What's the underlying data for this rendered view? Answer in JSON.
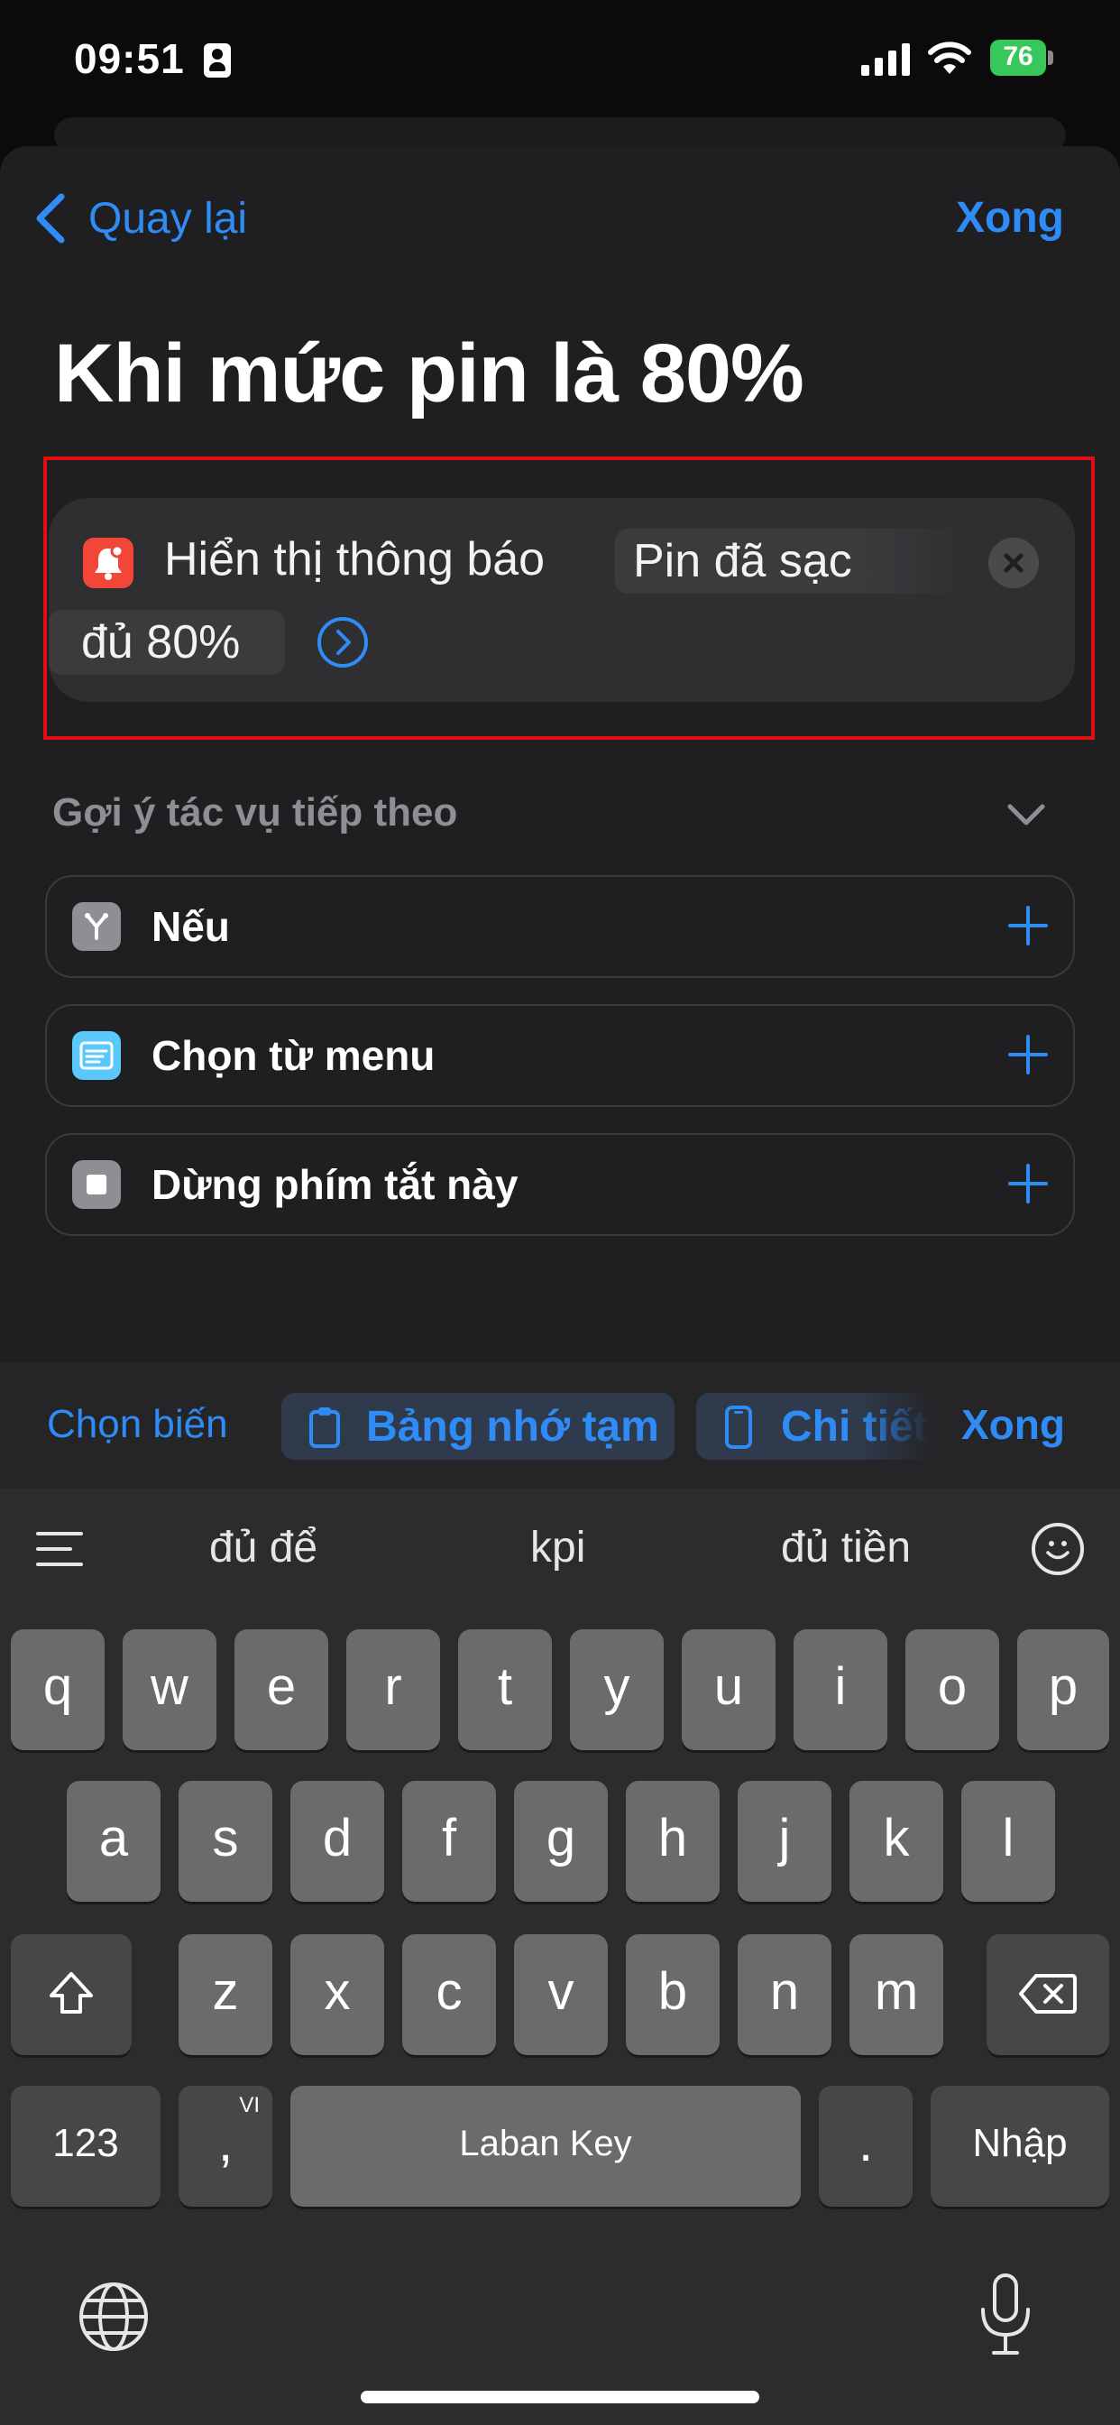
{
  "status_bar": {
    "time": "09:51",
    "battery": "76"
  },
  "nav": {
    "back_label": "Quay lại",
    "done_label": "Xong"
  },
  "title": "Khi mức pin là 80%",
  "action": {
    "label": "Hiển thị thông báo",
    "token_line1": "Pin đã sạc",
    "token_line2": "đủ 80%"
  },
  "suggestions": {
    "header": "Gợi ý tác vụ tiếp theo",
    "items": [
      {
        "label": "Nếu",
        "icon": "branch-icon",
        "color": "#8e8e93"
      },
      {
        "label": "Chọn từ menu",
        "icon": "menu-icon",
        "color": "#5ac8fa"
      },
      {
        "label": "Dừng phím tắt này",
        "icon": "stop-icon",
        "color": "#8e8e93"
      }
    ]
  },
  "variable_bar": {
    "choose_label": "Chọn biến",
    "chip1": "Bảng nhớ tạm",
    "chip2": "Chi tiết",
    "done_label": "Xong"
  },
  "keyboard": {
    "predictions": [
      "đủ để",
      "kpi",
      "đủ tiền"
    ],
    "row1": [
      "q",
      "w",
      "e",
      "r",
      "t",
      "y",
      "u",
      "i",
      "o",
      "p"
    ],
    "row2": [
      "a",
      "s",
      "d",
      "f",
      "g",
      "h",
      "j",
      "k",
      "l"
    ],
    "row3": [
      "z",
      "x",
      "c",
      "v",
      "b",
      "n",
      "m"
    ],
    "numbers_label": "123",
    "comma_label": ",",
    "lang_label": "VI",
    "space_label": "Laban Key",
    "period_label": ".",
    "return_label": "Nhập"
  },
  "colors": {
    "accent": "#2f8bf6",
    "highlight_border": "#e10f12",
    "notification_icon": "#f24638"
  }
}
